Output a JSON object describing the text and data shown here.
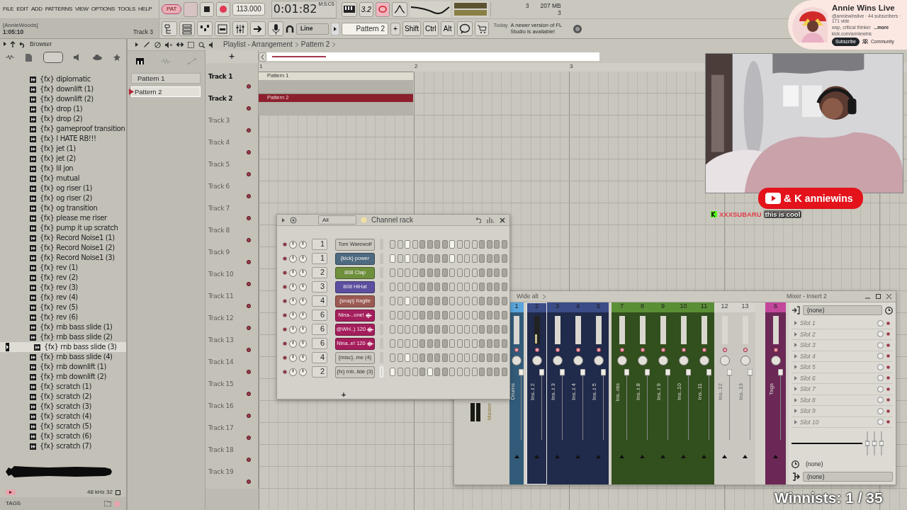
{
  "menu": [
    "FILE",
    "EDIT",
    "ADD",
    "PATTERNS",
    "VIEW",
    "OPTIONS",
    "TOOLS",
    "HELP"
  ],
  "hint": {
    "project": "[AnnieWoods]",
    "time": "1:05:10",
    "target": "Track 3"
  },
  "transport": {
    "mode": "PAT",
    "tempo": "113.000"
  },
  "clock": {
    "time": "0:01:82",
    "unit": "M:S:CS"
  },
  "countdown": "3.2",
  "monitor": {
    "cpu": "3",
    "memory": "207 MB",
    "polyphony": "3"
  },
  "toolbar": {
    "snap": "Line",
    "pattern": "Pattern 2",
    "add": "+",
    "keys": [
      "Shift",
      "Ctrl",
      "Alt"
    ]
  },
  "news": {
    "label": "Today",
    "text": "A newer version of FL Studio is available!"
  },
  "browser": {
    "title": "Browser",
    "sample_rate": "48 kHz 32",
    "tags": "TAGS",
    "items": [
      {
        "label": "{fx} diplomatic",
        "selected": false
      },
      {
        "label": "{fx} downlift (1)",
        "selected": false
      },
      {
        "label": "{fx} downlift (2)",
        "selected": false
      },
      {
        "label": "{fx} drop (1)",
        "selected": false
      },
      {
        "label": "{fx} drop (2)",
        "selected": false
      },
      {
        "label": "{fx} gameproof transition",
        "selected": false
      },
      {
        "label": "{fx} I HATE RB!!!",
        "selected": false
      },
      {
        "label": "{fx} jet (1)",
        "selected": false
      },
      {
        "label": "{fx} jet (2)",
        "selected": false
      },
      {
        "label": "{fx} lil jon",
        "selected": false
      },
      {
        "label": "{fx} mutual",
        "selected": false
      },
      {
        "label": "{fx} og riser (1)",
        "selected": false
      },
      {
        "label": "{fx} og riser (2)",
        "selected": false
      },
      {
        "label": "{fx} og transition",
        "selected": false
      },
      {
        "label": "{fx} please me riser",
        "selected": false
      },
      {
        "label": "{fx} pump it up scratch",
        "selected": false
      },
      {
        "label": "{fx} Record Noise1 (1)",
        "selected": false
      },
      {
        "label": "{fx} Record Noise1 (2)",
        "selected": false
      },
      {
        "label": "{fx} Record Noise1 (3)",
        "selected": false
      },
      {
        "label": "{fx} rev (1)",
        "selected": false
      },
      {
        "label": "{fx} rev (2)",
        "selected": false
      },
      {
        "label": "{fx} rev (3)",
        "selected": false
      },
      {
        "label": "{fx} rev (4)",
        "selected": false
      },
      {
        "label": "{fx} rev (5)",
        "selected": false
      },
      {
        "label": "{fx} rev (6)",
        "selected": false
      },
      {
        "label": "{fx} rnb bass slide (1)",
        "selected": false
      },
      {
        "label": "{fx} rnb bass slide (2)",
        "selected": false
      },
      {
        "label": "{fx} rnb bass slide (3)",
        "selected": true
      },
      {
        "label": "{fx} rnb bass slide (4)",
        "selected": false
      },
      {
        "label": "{fx} rnb downlift (1)",
        "selected": false
      },
      {
        "label": "{fx} rnb downlift (2)",
        "selected": false
      },
      {
        "label": "{fx} scratch (1)",
        "selected": false
      },
      {
        "label": "{fx} scratch (2)",
        "selected": false
      },
      {
        "label": "{fx} scratch (3)",
        "selected": false
      },
      {
        "label": "{fx} scratch (4)",
        "selected": false
      },
      {
        "label": "{fx} scratch (5)",
        "selected": false
      },
      {
        "label": "{fx} scratch (6)",
        "selected": false
      },
      {
        "label": "{fx} scratch (7)",
        "selected": false
      }
    ]
  },
  "playlist": {
    "title": "Playlist - Arrangement",
    "breadcrumb": "Pattern 2",
    "add": "+",
    "patterns": [
      {
        "name": "Pattern 1",
        "selected": false
      },
      {
        "name": "Pattern 2",
        "selected": true
      }
    ],
    "ruler": [
      "1",
      "2",
      "3"
    ],
    "tracks": [
      {
        "name": "Track 1",
        "active": true,
        "clip": {
          "label": "Pattern 1",
          "color": "#dedbd0"
        }
      },
      {
        "name": "Track 2",
        "active": true,
        "clip": {
          "label": "Pattern 2",
          "color": "#8c1f2c"
        }
      },
      {
        "name": "Track 3",
        "active": false
      },
      {
        "name": "Track 4",
        "active": false
      },
      {
        "name": "Track 5",
        "active": false
      },
      {
        "name": "Track 6",
        "active": false
      },
      {
        "name": "Track 7",
        "active": false
      },
      {
        "name": "Track 8",
        "active": false
      },
      {
        "name": "Track 9",
        "active": false
      },
      {
        "name": "Track 10",
        "active": false
      },
      {
        "name": "Track 11",
        "active": false
      },
      {
        "name": "Track 12",
        "active": false
      },
      {
        "name": "Track 13",
        "active": false
      },
      {
        "name": "Track 14",
        "active": false
      },
      {
        "name": "Track 15",
        "active": false
      },
      {
        "name": "Track 16",
        "active": false
      },
      {
        "name": "Track 17",
        "active": false
      },
      {
        "name": "Track 18",
        "active": false
      },
      {
        "name": "Track 19",
        "active": false
      }
    ]
  },
  "channel_rack": {
    "filter": "All",
    "title": "Channel rack",
    "add": "+",
    "channels": [
      {
        "number": "1",
        "name": "Tom Warewolf",
        "color": "#cbc8bf",
        "audio": false,
        "selected": false,
        "steps": [
          false,
          false,
          true,
          false,
          false,
          false,
          false,
          false,
          true,
          false,
          false,
          false,
          false,
          false,
          false,
          false
        ]
      },
      {
        "number": "1",
        "name": "{kick} power",
        "color": "#4d6a80",
        "audio": false,
        "selected": false,
        "steps": [
          true,
          false,
          true,
          false,
          false,
          false,
          false,
          false,
          true,
          false,
          false,
          false,
          false,
          false,
          false,
          false
        ]
      },
      {
        "number": "2",
        "name": "808 Clap",
        "color": "#6e8f3c",
        "audio": false,
        "selected": false,
        "steps": [
          false,
          false,
          false,
          false,
          false,
          false,
          false,
          false,
          false,
          false,
          false,
          false,
          false,
          false,
          false,
          false
        ]
      },
      {
        "number": "3",
        "name": "808 HiHat",
        "color": "#5c4fa0",
        "audio": false,
        "selected": false,
        "steps": [
          false,
          false,
          false,
          false,
          false,
          false,
          false,
          false,
          false,
          false,
          false,
          false,
          false,
          false,
          false,
          false
        ]
      },
      {
        "number": "4",
        "name": "{snap} fragile",
        "color": "#9b5a52",
        "audio": false,
        "selected": false,
        "steps": [
          false,
          false,
          true,
          false,
          false,
          false,
          false,
          false,
          false,
          false,
          false,
          false,
          false,
          false,
          false,
          false
        ]
      },
      {
        "number": "6",
        "name": "Nina-..one!",
        "color": "#a51e5c",
        "audio": true,
        "selected": false,
        "steps": [
          false,
          false,
          false,
          false,
          false,
          false,
          false,
          false,
          false,
          false,
          false,
          false,
          false,
          false,
          false,
          false
        ]
      },
      {
        "number": "6",
        "name": "@WH..) 120",
        "color": "#a51e5c",
        "audio": true,
        "selected": false,
        "steps": [
          false,
          false,
          false,
          false,
          false,
          false,
          false,
          false,
          false,
          false,
          false,
          false,
          false,
          false,
          false,
          false
        ]
      },
      {
        "number": "6",
        "name": "Nina..e! 120",
        "color": "#a51e5c",
        "audio": true,
        "selected": false,
        "steps": [
          false,
          false,
          false,
          false,
          false,
          false,
          false,
          false,
          false,
          false,
          false,
          false,
          false,
          false,
          false,
          false
        ]
      },
      {
        "number": "4",
        "name": "{misc}..me (4)",
        "color": "#cbc8bf",
        "audio": false,
        "selected": false,
        "steps": [
          false,
          false,
          true,
          false,
          false,
          false,
          false,
          false,
          false,
          false,
          false,
          false,
          false,
          false,
          false,
          false
        ]
      },
      {
        "number": "2",
        "name": "{fx} rnb..lide (3)",
        "color": "#cbc8bf",
        "audio": false,
        "selected": true,
        "steps": [
          true,
          false,
          false,
          false,
          false,
          true,
          false,
          false,
          false,
          false,
          false,
          false,
          false,
          false,
          false,
          false
        ]
      }
    ]
  },
  "mixer": {
    "preset": "Wide alt",
    "title": "Mixer - Insert 2",
    "master": "Master",
    "input": "(none)",
    "eq_target": "(none)",
    "output": "(none)",
    "inserts": [
      {
        "number": "1",
        "label": "Drums",
        "color": "#5aa5dc",
        "selected": false
      },
      {
        "number": "2",
        "label": "Ins..t 2",
        "color": "#3b4c86",
        "selected": true
      },
      {
        "number": "3",
        "label": "Ins..t 3",
        "color": "#3b4c86",
        "selected": false
      },
      {
        "number": "4",
        "label": "Ins..t 4",
        "color": "#3b4c86",
        "selected": false
      },
      {
        "number": "5",
        "label": "Ins..t 5",
        "color": "#3b4c86",
        "selected": false
      },
      {
        "number": "7",
        "label": "Ins..nts",
        "color": "#5b8f36",
        "selected": false
      },
      {
        "number": "8",
        "label": "Ins..t 8",
        "color": "#5b8f36",
        "selected": false
      },
      {
        "number": "9",
        "label": "Ins..t 9",
        "color": "#5b8f36",
        "selected": false
      },
      {
        "number": "10",
        "label": "Ins..10",
        "color": "#5b8f36",
        "selected": false
      },
      {
        "number": "11",
        "label": "Ins..11",
        "color": "#5b8f36",
        "selected": false
      },
      {
        "number": "12",
        "label": "Ins..12",
        "color": "#d6d4cd",
        "selected": false
      },
      {
        "number": "13",
        "label": "Ins..13",
        "color": "#d6d4cd",
        "selected": false
      },
      {
        "number": "6",
        "label": "Tags",
        "color": "#c2479b",
        "selected": false
      }
    ],
    "slots": [
      "Slot 1",
      "Slot 2",
      "Slot 3",
      "Slot 4",
      "Slot 5",
      "Slot 6",
      "Slot 7",
      "Slot 8",
      "Slot 9",
      "Slot 10"
    ]
  },
  "channel_card": {
    "name": "Annie Wins Live",
    "stats": "@anniewinslive · 44 subscribers · 171 vide",
    "bio": "wsp, critical thinker",
    "more": "...more",
    "link": "kick.com/anniewins",
    "subscribe": "Subscribe",
    "community": "Community"
  },
  "badge": {
    "joiner": "& K",
    "handle": "anniewins"
  },
  "chat": {
    "user": "XXXSUBARU",
    "message": "this is cool"
  },
  "counter": "Winnists: 1 / 35"
}
